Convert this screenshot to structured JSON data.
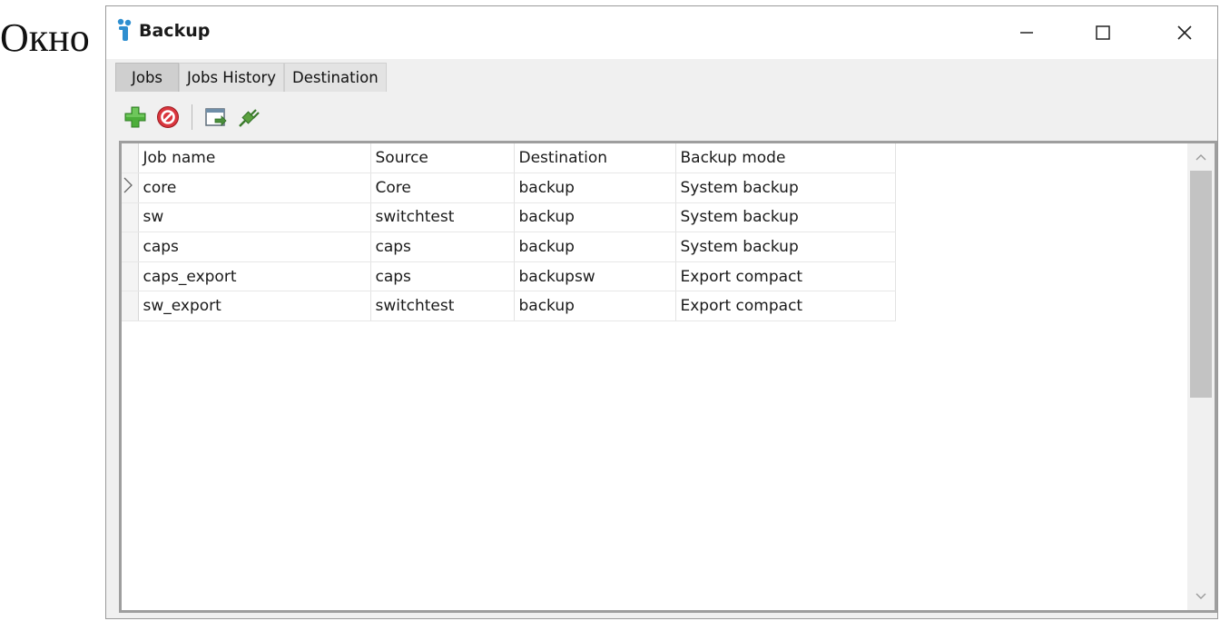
{
  "page_caption": "Окно",
  "window": {
    "title": "Backup",
    "controls": {
      "minimize": "minimize-icon",
      "maximize": "maximize-icon",
      "close": "close-icon"
    }
  },
  "tabs": [
    {
      "label": "Jobs",
      "active": true
    },
    {
      "label": "Jobs History",
      "active": false
    },
    {
      "label": "Destination",
      "active": false
    }
  ],
  "toolbar": {
    "buttons": [
      {
        "icon": "add-icon",
        "color": "#4cae3a"
      },
      {
        "icon": "delete-icon",
        "color": "#d9363e"
      },
      {
        "icon": "export-icon",
        "color": "#4a8f3b"
      },
      {
        "icon": "connect-icon",
        "color": "#5aa03e"
      }
    ]
  },
  "grid": {
    "columns": [
      "Job name",
      "Source",
      "Destination",
      "Backup mode"
    ],
    "current_row": 0,
    "rows": [
      [
        "core",
        "Core",
        "backup",
        "System backup"
      ],
      [
        "sw",
        "switchtest",
        "backup",
        "System backup"
      ],
      [
        "caps",
        "caps",
        "backup",
        "System backup"
      ],
      [
        "caps_export",
        "caps",
        "backupsw",
        "Export compact"
      ],
      [
        "sw_export",
        "switchtest",
        "backup",
        "Export compact"
      ]
    ]
  }
}
